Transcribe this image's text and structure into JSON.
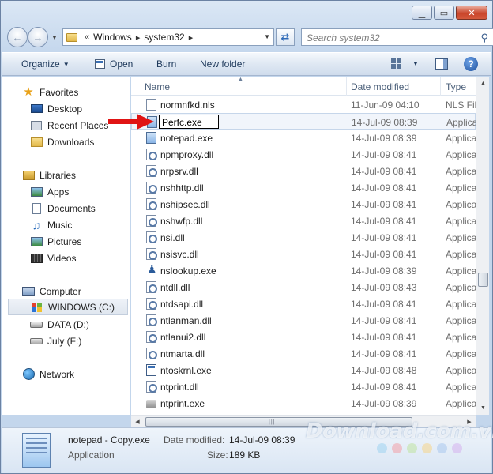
{
  "navigation": {
    "path": [
      "Windows",
      "system32"
    ],
    "overflow_glyph": "«",
    "search_placeholder": "Search system32"
  },
  "toolbar": {
    "organize": "Organize",
    "open": "Open",
    "burn": "Burn",
    "new_folder": "New folder"
  },
  "nav_pane": {
    "favorites": {
      "label": "Favorites",
      "items": [
        "Desktop",
        "Recent Places",
        "Downloads"
      ]
    },
    "libraries": {
      "label": "Libraries",
      "items": [
        "Apps",
        "Documents",
        "Music",
        "Pictures",
        "Videos"
      ]
    },
    "computer": {
      "label": "Computer",
      "items": [
        "WINDOWS (C:)",
        "DATA (D:)",
        "July (F:)"
      ]
    },
    "network": {
      "label": "Network"
    }
  },
  "columns": {
    "name": "Name",
    "date": "Date modified",
    "type": "Type"
  },
  "files": [
    {
      "name": "normnfkd.nls",
      "date": "11-Jun-09 04:10",
      "type": "NLS File",
      "icon": "blank-file-icon"
    },
    {
      "name": "Perfc.exe",
      "date": "14-Jul-09 08:39",
      "type": "Application",
      "icon": "application-icon",
      "renaming": true
    },
    {
      "name": "notepad.exe",
      "date": "14-Jul-09 08:39",
      "type": "Application",
      "icon": "notepad-icon"
    },
    {
      "name": "npmproxy.dll",
      "date": "14-Jul-09 08:41",
      "type": "Application",
      "icon": "dll-icon"
    },
    {
      "name": "nrpsrv.dll",
      "date": "14-Jul-09 08:41",
      "type": "Application",
      "icon": "dll-icon"
    },
    {
      "name": "nshhttp.dll",
      "date": "14-Jul-09 08:41",
      "type": "Application",
      "icon": "dll-icon"
    },
    {
      "name": "nshipsec.dll",
      "date": "14-Jul-09 08:41",
      "type": "Application",
      "icon": "dll-icon"
    },
    {
      "name": "nshwfp.dll",
      "date": "14-Jul-09 08:41",
      "type": "Application",
      "icon": "dll-icon"
    },
    {
      "name": "nsi.dll",
      "date": "14-Jul-09 08:41",
      "type": "Application",
      "icon": "dll-icon"
    },
    {
      "name": "nsisvc.dll",
      "date": "14-Jul-09 08:41",
      "type": "Application",
      "icon": "dll-icon"
    },
    {
      "name": "nslookup.exe",
      "date": "14-Jul-09 08:39",
      "type": "Application",
      "icon": "person-app-icon"
    },
    {
      "name": "ntdll.dll",
      "date": "14-Jul-09 08:43",
      "type": "Application",
      "icon": "dll-icon"
    },
    {
      "name": "ntdsapi.dll",
      "date": "14-Jul-09 08:41",
      "type": "Application",
      "icon": "dll-icon"
    },
    {
      "name": "ntlanman.dll",
      "date": "14-Jul-09 08:41",
      "type": "Application",
      "icon": "dll-icon"
    },
    {
      "name": "ntlanui2.dll",
      "date": "14-Jul-09 08:41",
      "type": "Application",
      "icon": "dll-icon"
    },
    {
      "name": "ntmarta.dll",
      "date": "14-Jul-09 08:41",
      "type": "Application",
      "icon": "dll-icon"
    },
    {
      "name": "ntoskrnl.exe",
      "date": "14-Jul-09 08:48",
      "type": "Application",
      "icon": "window-app-icon"
    },
    {
      "name": "ntprint.dll",
      "date": "14-Jul-09 08:41",
      "type": "Application",
      "icon": "dll-icon"
    },
    {
      "name": "ntprint.exe",
      "date": "14-Jul-09 08:39",
      "type": "Application",
      "icon": "printer-icon"
    }
  ],
  "details": {
    "name": "notepad - Copy.exe",
    "type": "Application",
    "date_label": "Date modified:",
    "date_value": "14-Jul-09 08:39",
    "size_label": "Size:",
    "size_value": "189 KB"
  },
  "watermark": {
    "text": "Download.com.vn",
    "dot_colors": [
      "#9fd3f0",
      "#f2a0a8",
      "#bfe3a0",
      "#f5d58a",
      "#a9c8ef",
      "#d5b3ef"
    ]
  },
  "colors": {
    "annotation_arrow": "#e01414",
    "window_frame": "#c3d6ec"
  }
}
